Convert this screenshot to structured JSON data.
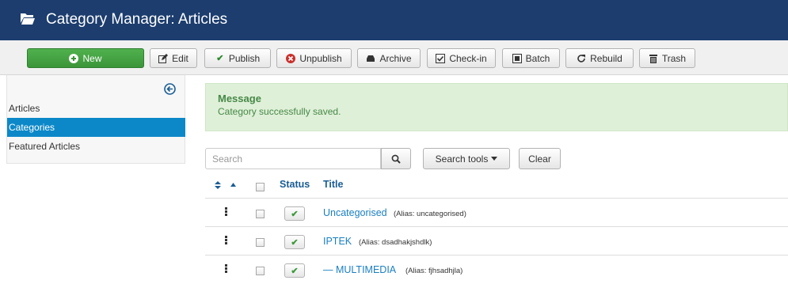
{
  "header": {
    "title": "Category Manager: Articles",
    "icon": "folder-open-icon"
  },
  "toolbar": {
    "new": "New",
    "edit": "Edit",
    "publish": "Publish",
    "unpublish": "Unpublish",
    "archive": "Archive",
    "checkin": "Check-in",
    "batch": "Batch",
    "rebuild": "Rebuild",
    "trash": "Trash"
  },
  "sidebar": {
    "items": [
      {
        "label": "Articles",
        "active": false
      },
      {
        "label": "Categories",
        "active": true
      },
      {
        "label": "Featured Articles",
        "active": false
      }
    ]
  },
  "message": {
    "heading": "Message",
    "text": "Category successfully saved."
  },
  "filters": {
    "search_placeholder": "Search",
    "search_tools": "Search tools",
    "clear": "Clear"
  },
  "table": {
    "columns": {
      "status": "Status",
      "title": "Title"
    },
    "rows": [
      {
        "title": "Uncategorised",
        "alias": "(Alias: uncategorised)"
      },
      {
        "title": "IPTEK",
        "alias": "(Alias: dsadhakjshdlk)"
      },
      {
        "title": "— MULTIMEDIA",
        "alias": "(Alias: fjhsadhjla)"
      }
    ]
  },
  "colors": {
    "header_bg": "#1c3d6e",
    "new_button": "#46a546",
    "active_sidebar": "#0c88c8",
    "message_bg": "#dff0d8",
    "link": "#1a7fc1"
  }
}
